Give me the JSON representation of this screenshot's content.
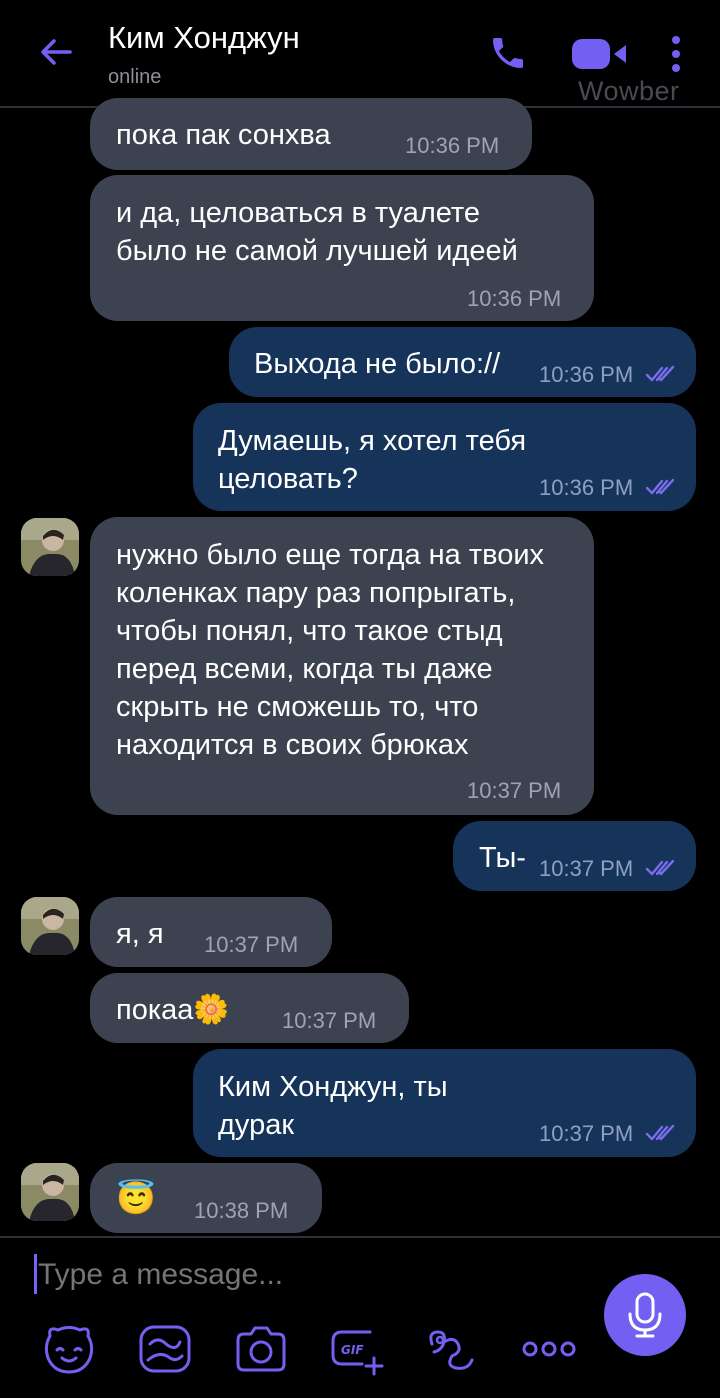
{
  "header": {
    "contact_name": "Ким Хонджун",
    "status": "online",
    "watermark": "Wowber",
    "icons": [
      "back-arrow-icon",
      "phone-icon",
      "video-camera-icon",
      "more-vertical-icon"
    ]
  },
  "colors": {
    "accent": "#7360f2",
    "incoming_bubble": "#3d4250",
    "outgoing_bubble": "#163459",
    "background": "#000000"
  },
  "messages": [
    {
      "direction": "incoming",
      "text": "пока пак сонхва",
      "time": "10:36 PM"
    },
    {
      "direction": "incoming",
      "text": "и да, целоваться в туалете было не самой лучшей идеей",
      "time": "10:36 PM"
    },
    {
      "direction": "outgoing",
      "text": "Выхода не было://",
      "time": "10:36 PM",
      "read": true
    },
    {
      "direction": "outgoing",
      "text": "Думаешь, я хотел тебя целовать?",
      "time": "10:36 PM",
      "read": true
    },
    {
      "direction": "incoming",
      "text": "нужно было еще тогда на твоих коленках пару раз попрыгать, чтобы понял, что такое стыд перед всеми, когда ты даже скрыть не сможешь то, что находится в своих брюках",
      "time": "10:37 PM",
      "avatar": true
    },
    {
      "direction": "outgoing",
      "text": "Ты-",
      "time": "10:37 PM",
      "read": true
    },
    {
      "direction": "incoming",
      "text": "я, я",
      "time": "10:37 PM",
      "avatar": true
    },
    {
      "direction": "incoming",
      "text": "покаа🌼",
      "time": "10:37 PM"
    },
    {
      "direction": "outgoing",
      "text": "Ким Хонджун, ты дурак",
      "time": "10:37 PM",
      "read": true
    },
    {
      "direction": "incoming",
      "text": "😇",
      "time": "10:38 PM",
      "avatar": true
    }
  ],
  "composer": {
    "placeholder": "Type a message...",
    "tools": [
      "sticker-icon",
      "doodle-icon",
      "camera-icon",
      "gif-icon",
      "location-icon",
      "more-horizontal-icon"
    ],
    "send_icon": "microphone-icon"
  }
}
